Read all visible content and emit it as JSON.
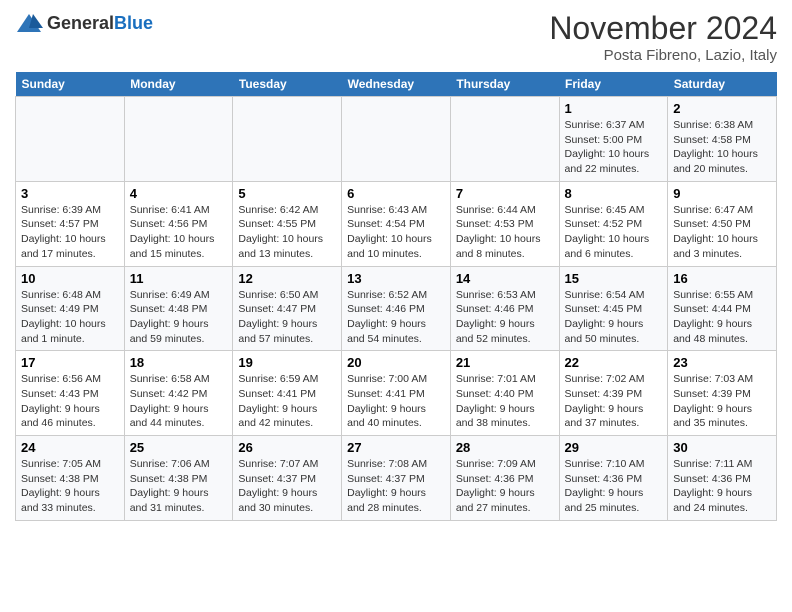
{
  "header": {
    "logo_line1": "General",
    "logo_line2": "Blue",
    "month": "November 2024",
    "location": "Posta Fibreno, Lazio, Italy"
  },
  "weekdays": [
    "Sunday",
    "Monday",
    "Tuesday",
    "Wednesday",
    "Thursday",
    "Friday",
    "Saturday"
  ],
  "weeks": [
    [
      {
        "day": "",
        "sunrise": "",
        "sunset": "",
        "daylight": ""
      },
      {
        "day": "",
        "sunrise": "",
        "sunset": "",
        "daylight": ""
      },
      {
        "day": "",
        "sunrise": "",
        "sunset": "",
        "daylight": ""
      },
      {
        "day": "",
        "sunrise": "",
        "sunset": "",
        "daylight": ""
      },
      {
        "day": "",
        "sunrise": "",
        "sunset": "",
        "daylight": ""
      },
      {
        "day": "1",
        "sunrise": "Sunrise: 6:37 AM",
        "sunset": "Sunset: 5:00 PM",
        "daylight": "Daylight: 10 hours and 22 minutes."
      },
      {
        "day": "2",
        "sunrise": "Sunrise: 6:38 AM",
        "sunset": "Sunset: 4:58 PM",
        "daylight": "Daylight: 10 hours and 20 minutes."
      }
    ],
    [
      {
        "day": "3",
        "sunrise": "Sunrise: 6:39 AM",
        "sunset": "Sunset: 4:57 PM",
        "daylight": "Daylight: 10 hours and 17 minutes."
      },
      {
        "day": "4",
        "sunrise": "Sunrise: 6:41 AM",
        "sunset": "Sunset: 4:56 PM",
        "daylight": "Daylight: 10 hours and 15 minutes."
      },
      {
        "day": "5",
        "sunrise": "Sunrise: 6:42 AM",
        "sunset": "Sunset: 4:55 PM",
        "daylight": "Daylight: 10 hours and 13 minutes."
      },
      {
        "day": "6",
        "sunrise": "Sunrise: 6:43 AM",
        "sunset": "Sunset: 4:54 PM",
        "daylight": "Daylight: 10 hours and 10 minutes."
      },
      {
        "day": "7",
        "sunrise": "Sunrise: 6:44 AM",
        "sunset": "Sunset: 4:53 PM",
        "daylight": "Daylight: 10 hours and 8 minutes."
      },
      {
        "day": "8",
        "sunrise": "Sunrise: 6:45 AM",
        "sunset": "Sunset: 4:52 PM",
        "daylight": "Daylight: 10 hours and 6 minutes."
      },
      {
        "day": "9",
        "sunrise": "Sunrise: 6:47 AM",
        "sunset": "Sunset: 4:50 PM",
        "daylight": "Daylight: 10 hours and 3 minutes."
      }
    ],
    [
      {
        "day": "10",
        "sunrise": "Sunrise: 6:48 AM",
        "sunset": "Sunset: 4:49 PM",
        "daylight": "Daylight: 10 hours and 1 minute."
      },
      {
        "day": "11",
        "sunrise": "Sunrise: 6:49 AM",
        "sunset": "Sunset: 4:48 PM",
        "daylight": "Daylight: 9 hours and 59 minutes."
      },
      {
        "day": "12",
        "sunrise": "Sunrise: 6:50 AM",
        "sunset": "Sunset: 4:47 PM",
        "daylight": "Daylight: 9 hours and 57 minutes."
      },
      {
        "day": "13",
        "sunrise": "Sunrise: 6:52 AM",
        "sunset": "Sunset: 4:46 PM",
        "daylight": "Daylight: 9 hours and 54 minutes."
      },
      {
        "day": "14",
        "sunrise": "Sunrise: 6:53 AM",
        "sunset": "Sunset: 4:46 PM",
        "daylight": "Daylight: 9 hours and 52 minutes."
      },
      {
        "day": "15",
        "sunrise": "Sunrise: 6:54 AM",
        "sunset": "Sunset: 4:45 PM",
        "daylight": "Daylight: 9 hours and 50 minutes."
      },
      {
        "day": "16",
        "sunrise": "Sunrise: 6:55 AM",
        "sunset": "Sunset: 4:44 PM",
        "daylight": "Daylight: 9 hours and 48 minutes."
      }
    ],
    [
      {
        "day": "17",
        "sunrise": "Sunrise: 6:56 AM",
        "sunset": "Sunset: 4:43 PM",
        "daylight": "Daylight: 9 hours and 46 minutes."
      },
      {
        "day": "18",
        "sunrise": "Sunrise: 6:58 AM",
        "sunset": "Sunset: 4:42 PM",
        "daylight": "Daylight: 9 hours and 44 minutes."
      },
      {
        "day": "19",
        "sunrise": "Sunrise: 6:59 AM",
        "sunset": "Sunset: 4:41 PM",
        "daylight": "Daylight: 9 hours and 42 minutes."
      },
      {
        "day": "20",
        "sunrise": "Sunrise: 7:00 AM",
        "sunset": "Sunset: 4:41 PM",
        "daylight": "Daylight: 9 hours and 40 minutes."
      },
      {
        "day": "21",
        "sunrise": "Sunrise: 7:01 AM",
        "sunset": "Sunset: 4:40 PM",
        "daylight": "Daylight: 9 hours and 38 minutes."
      },
      {
        "day": "22",
        "sunrise": "Sunrise: 7:02 AM",
        "sunset": "Sunset: 4:39 PM",
        "daylight": "Daylight: 9 hours and 37 minutes."
      },
      {
        "day": "23",
        "sunrise": "Sunrise: 7:03 AM",
        "sunset": "Sunset: 4:39 PM",
        "daylight": "Daylight: 9 hours and 35 minutes."
      }
    ],
    [
      {
        "day": "24",
        "sunrise": "Sunrise: 7:05 AM",
        "sunset": "Sunset: 4:38 PM",
        "daylight": "Daylight: 9 hours and 33 minutes."
      },
      {
        "day": "25",
        "sunrise": "Sunrise: 7:06 AM",
        "sunset": "Sunset: 4:38 PM",
        "daylight": "Daylight: 9 hours and 31 minutes."
      },
      {
        "day": "26",
        "sunrise": "Sunrise: 7:07 AM",
        "sunset": "Sunset: 4:37 PM",
        "daylight": "Daylight: 9 hours and 30 minutes."
      },
      {
        "day": "27",
        "sunrise": "Sunrise: 7:08 AM",
        "sunset": "Sunset: 4:37 PM",
        "daylight": "Daylight: 9 hours and 28 minutes."
      },
      {
        "day": "28",
        "sunrise": "Sunrise: 7:09 AM",
        "sunset": "Sunset: 4:36 PM",
        "daylight": "Daylight: 9 hours and 27 minutes."
      },
      {
        "day": "29",
        "sunrise": "Sunrise: 7:10 AM",
        "sunset": "Sunset: 4:36 PM",
        "daylight": "Daylight: 9 hours and 25 minutes."
      },
      {
        "day": "30",
        "sunrise": "Sunrise: 7:11 AM",
        "sunset": "Sunset: 4:36 PM",
        "daylight": "Daylight: 9 hours and 24 minutes."
      }
    ]
  ]
}
